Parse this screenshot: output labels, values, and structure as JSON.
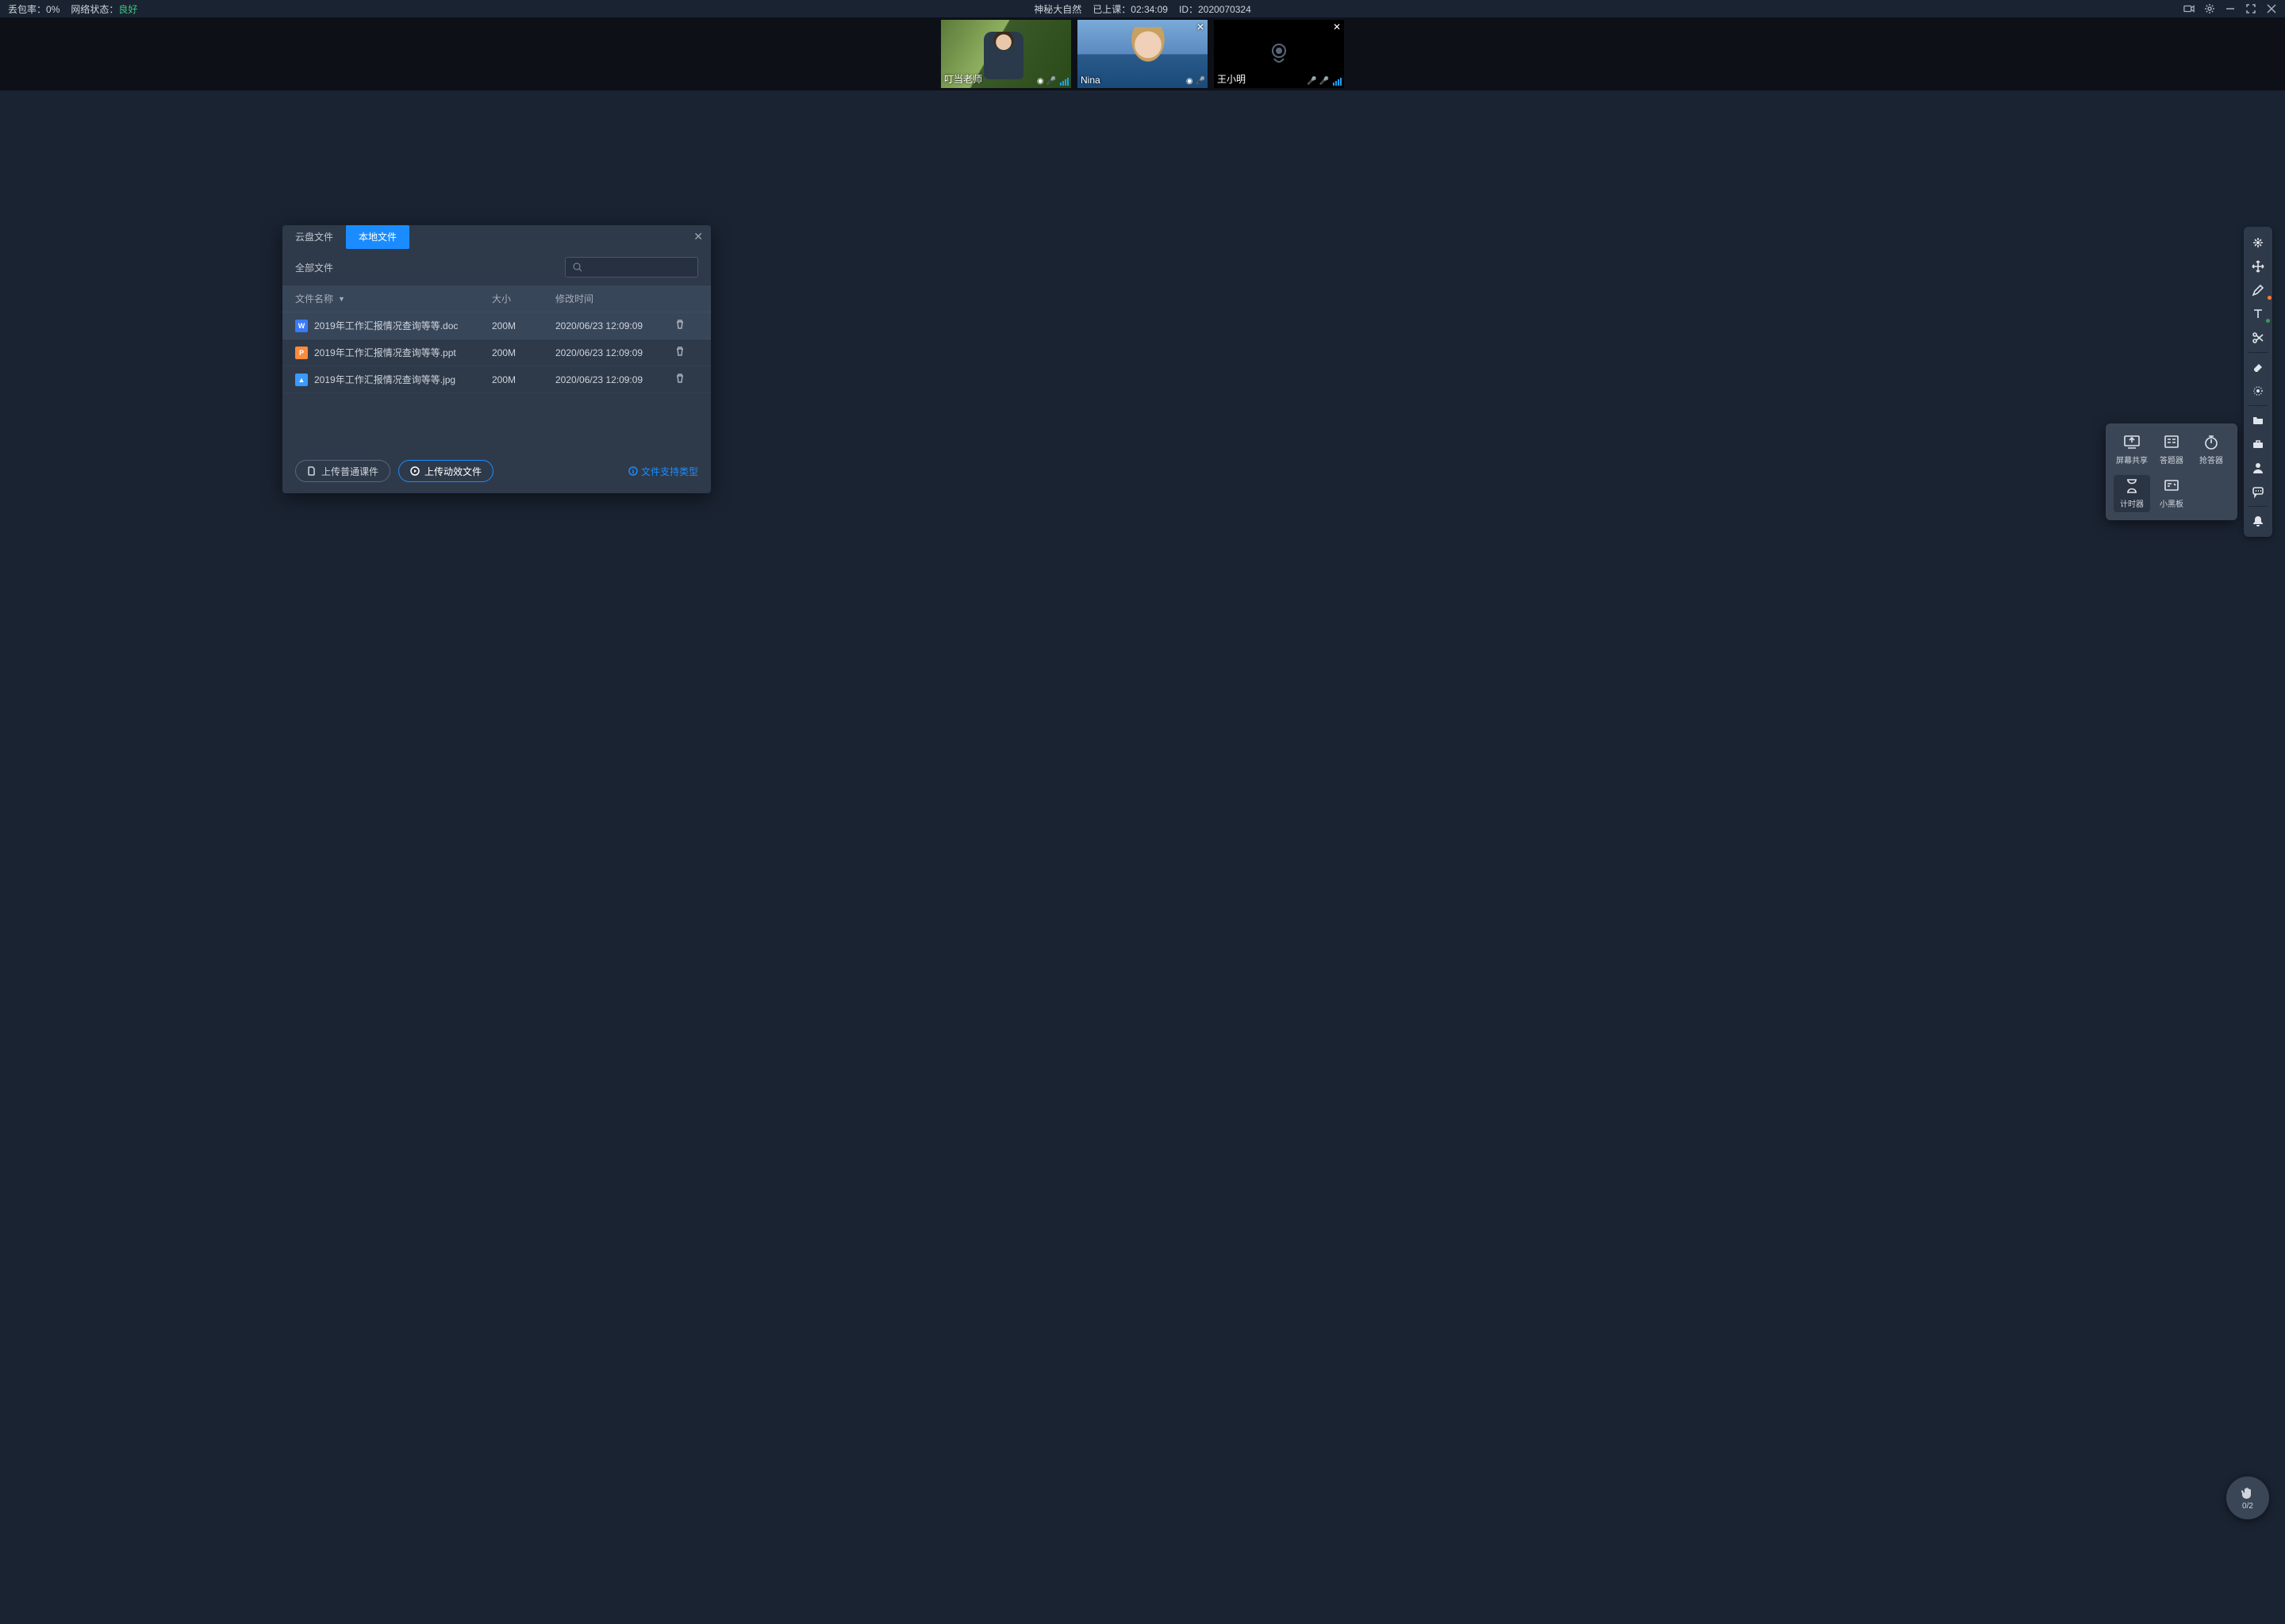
{
  "topbar": {
    "packet_loss_label": "丢包率：",
    "packet_loss_value": "0%",
    "network_label": "网络状态：",
    "network_value": "良好",
    "course_name": "神秘大自然",
    "elapsed_label": "已上课：",
    "elapsed_value": "02:34:09",
    "id_label": "ID：",
    "id_value": "2020070324"
  },
  "participants": [
    {
      "name": "叮当老师",
      "camera": "on",
      "close": false
    },
    {
      "name": "Nina",
      "camera": "on",
      "close": true
    },
    {
      "name": "王小明",
      "camera": "off",
      "close": true
    }
  ],
  "dialog": {
    "tabs": {
      "cloud": "云盘文件",
      "local": "本地文件"
    },
    "filter_label": "全部文件",
    "columns": {
      "name": "文件名称",
      "size": "大小",
      "time": "修改时间"
    },
    "files": [
      {
        "icon": "doc",
        "icon_letter": "W",
        "name": "2019年工作汇报情况查询等等.doc",
        "size": "200M",
        "time": "2020/06/23 12:09:09"
      },
      {
        "icon": "ppt",
        "icon_letter": "P",
        "name": "2019年工作汇报情况查询等等.ppt",
        "size": "200M",
        "time": "2020/06/23 12:09:09"
      },
      {
        "icon": "img",
        "icon_letter": "▲",
        "name": "2019年工作汇报情况查询等等.jpg",
        "size": "200M",
        "time": "2020/06/23 12:09:09"
      }
    ],
    "upload_normal": "上传普通课件",
    "upload_anim": "上传动效文件",
    "supported_types": "文件支持类型"
  },
  "toolbox": {
    "screen_share": "屏幕共享",
    "answer": "答题器",
    "race": "抢答器",
    "timer": "计时器",
    "board": "小黑板"
  },
  "hand": {
    "count": "0/2"
  }
}
